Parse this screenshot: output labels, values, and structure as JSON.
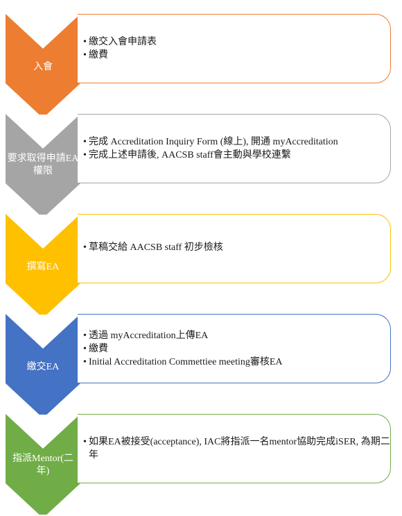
{
  "steps": [
    {
      "label": "入會",
      "color": "#ED7D31",
      "bullets": [
        "繳交入會申請表",
        "繳費"
      ]
    },
    {
      "label": "要求取得申請EA權限",
      "color": "#A5A5A5",
      "bullets": [
        "完成 Accreditation Inquiry Form (線上), 開通 myAccreditation",
        "完成上述申請後, AACSB staff會主動與學校連繫"
      ]
    },
    {
      "label": "撰寫EA",
      "color": "#FFC000",
      "bullets": [
        "草稿交給 AACSB staff 初步檢核"
      ]
    },
    {
      "label": "繳交EA",
      "color": "#4472C4",
      "bullets": [
        "透過 myAccreditation上傳EA",
        "繳費",
        "Initial Accreditation Commettiee meeting審核EA"
      ]
    },
    {
      "label": "指派Mentor(二年)",
      "color": "#70AD47",
      "bullets": [
        "如果EA被接受(acceptance), IAC將指派一名mentor協助完成iSER, 為期二年"
      ]
    }
  ]
}
